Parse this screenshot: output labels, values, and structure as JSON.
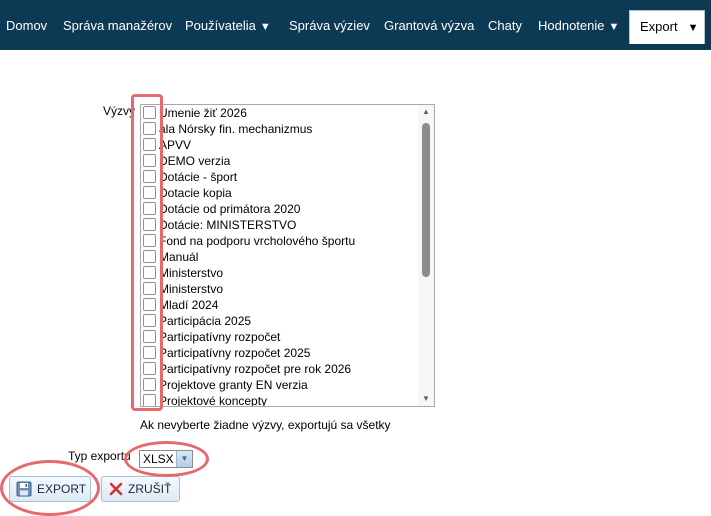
{
  "nav": {
    "items": [
      {
        "label": "Domov"
      },
      {
        "label": "Správa manažérov"
      },
      {
        "label": "Používatelia",
        "arrow": "▼"
      },
      {
        "label": "Správa výziev"
      },
      {
        "label": "Grantová výzva"
      },
      {
        "label": "Chaty"
      },
      {
        "label": "Hodnotenie",
        "arrow": "▼"
      },
      {
        "label": "Export",
        "arrow": "▼"
      }
    ]
  },
  "form": {
    "calls_label": "Výzvy",
    "calls": [
      "Umenie žiť 2026",
      "ala Nórsky fin. mechanizmus",
      "APVV",
      "DEMO verzia",
      "Dotácie - šport",
      "Dotacie kopia",
      "Dotácie od primátora 2020",
      "Dotácie: MINISTERSTVO",
      "Fond na podporu vrcholového športu",
      "Manuál",
      "Ministerstvo",
      "Ministerstvo",
      "Mladí 2024",
      "Participácia 2025",
      "Participatívny rozpočet",
      "Participatívny rozpočet 2025",
      "Participatívny rozpočet pre rok 2026",
      "Projektove granty EN verzia",
      "Projektové koncepty"
    ],
    "hint": "Ak nevyberte žiadne výzvy, exportujú sa všetky",
    "export_type_label": "Typ exportu",
    "export_type_value": "XLSX",
    "export_button": "EXPORT",
    "cancel_button": "ZRUŠIŤ"
  },
  "colors": {
    "navbar": "#0c3a55",
    "highlight": "#e46a6e",
    "cancel_icon": "#d0342c"
  }
}
